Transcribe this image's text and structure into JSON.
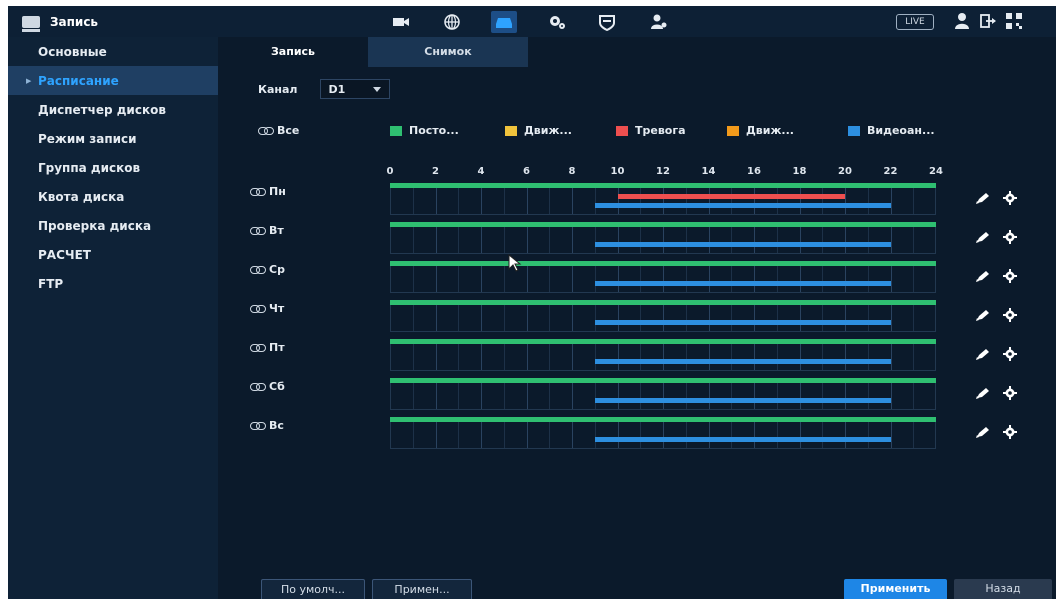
{
  "app": {
    "title": "Запись"
  },
  "topbar": {
    "icons": [
      "camera-icon",
      "network-icon",
      "storage-icon",
      "settings-icon",
      "security-icon",
      "account-icon"
    ],
    "live_label": "LIVE",
    "right_icons": [
      "user-icon",
      "logout-icon",
      "qr-code-icon"
    ]
  },
  "sidebar": {
    "items": [
      {
        "label": "Основные",
        "active": false
      },
      {
        "label": "Расписание",
        "active": true
      },
      {
        "label": "Диспетчер дисков",
        "active": false
      },
      {
        "label": "Режим записи",
        "active": false
      },
      {
        "label": "Группа дисков",
        "active": false
      },
      {
        "label": "Квота диска",
        "active": false
      },
      {
        "label": "Проверка диска",
        "active": false
      },
      {
        "label": "РАСЧЕТ",
        "active": false
      },
      {
        "label": "FTP",
        "active": false
      }
    ]
  },
  "tabs": [
    {
      "label": "Запись",
      "selected": true
    },
    {
      "label": "Снимок",
      "selected": false
    }
  ],
  "channel": {
    "label": "Канал",
    "value": "D1"
  },
  "legend": {
    "all_label": "Все",
    "items": [
      {
        "label": "Посто...",
        "color": "#2fbf71"
      },
      {
        "label": "Движ...",
        "color": "#f0c33c"
      },
      {
        "label": "Тревога",
        "color": "#ee4f4f"
      },
      {
        "label": "Движ...",
        "color": "#f29a1b"
      },
      {
        "label": "Видеоан...",
        "color": "#2d8fe0"
      }
    ]
  },
  "timeline": {
    "hour_labels": [
      "0",
      "2",
      "4",
      "6",
      "8",
      "10",
      "12",
      "14",
      "16",
      "18",
      "20",
      "22",
      "24"
    ]
  },
  "schedule": [
    {
      "day": "Пн",
      "bars": [
        {
          "color": "#2fbf71",
          "start": 0,
          "end": 24
        },
        {
          "color": "#ee4f4f",
          "start": 10,
          "end": 20
        },
        {
          "color": "#2d8fe0",
          "start": 9,
          "end": 22
        }
      ]
    },
    {
      "day": "Вт",
      "bars": [
        {
          "color": "#2fbf71",
          "start": 0,
          "end": 24
        },
        {
          "color": "#2d8fe0",
          "start": 9,
          "end": 22
        }
      ]
    },
    {
      "day": "Ср",
      "bars": [
        {
          "color": "#2fbf71",
          "start": 0,
          "end": 24
        },
        {
          "color": "#2d8fe0",
          "start": 9,
          "end": 22
        }
      ]
    },
    {
      "day": "Чт",
      "bars": [
        {
          "color": "#2fbf71",
          "start": 0,
          "end": 24
        },
        {
          "color": "#2d8fe0",
          "start": 9,
          "end": 22
        }
      ]
    },
    {
      "day": "Пт",
      "bars": [
        {
          "color": "#2fbf71",
          "start": 0,
          "end": 24
        },
        {
          "color": "#2d8fe0",
          "start": 9,
          "end": 22
        }
      ]
    },
    {
      "day": "Сб",
      "bars": [
        {
          "color": "#2fbf71",
          "start": 0,
          "end": 24
        },
        {
          "color": "#2d8fe0",
          "start": 9,
          "end": 22
        }
      ]
    },
    {
      "day": "Вс",
      "bars": [
        {
          "color": "#2fbf71",
          "start": 0,
          "end": 24
        },
        {
          "color": "#2d8fe0",
          "start": 9,
          "end": 22
        }
      ]
    }
  ],
  "buttons": {
    "default_label": "По умолч...",
    "apply_to_label": "Примен...",
    "apply_label": "Применить",
    "back_label": "Назад"
  }
}
